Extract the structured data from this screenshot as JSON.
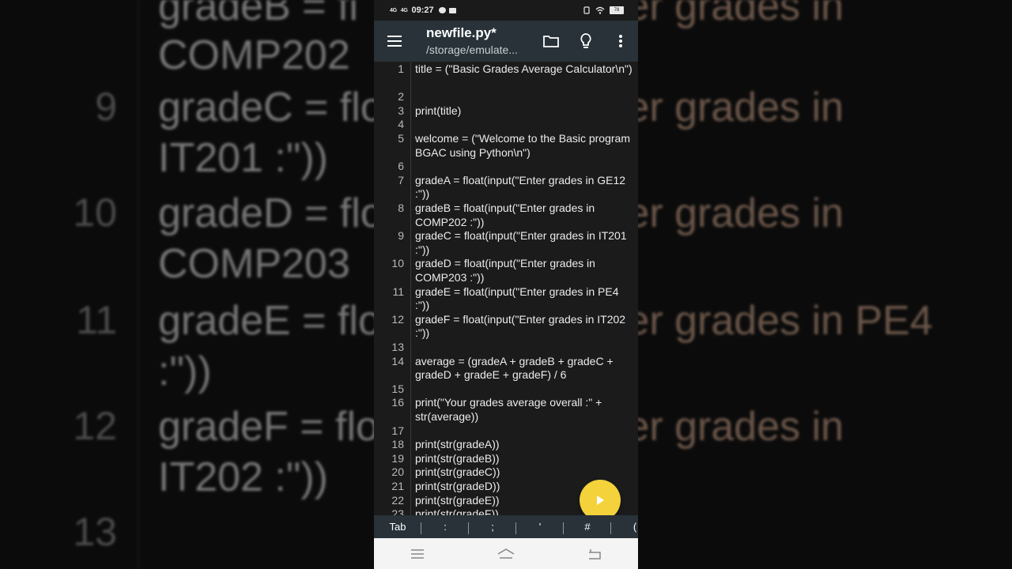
{
  "background": {
    "rows": [
      {
        "num": "",
        "text": "gradeB = fl",
        "right": "ter grades in"
      },
      {
        "num": "",
        "text": "COMP202",
        "right": ""
      },
      {
        "num": "9",
        "text": "gradeC = flo",
        "right": "ter grades in"
      },
      {
        "num": "",
        "text": "IT201 :\"))",
        "right": ""
      },
      {
        "num": "10",
        "text": "gradeD = flo",
        "right": "ter grades in"
      },
      {
        "num": "",
        "text": "COMP203",
        "right": ""
      },
      {
        "num": "11",
        "text": "gradeE = flo",
        "right": "ter grades in PE4"
      },
      {
        "num": "",
        "text": ":\"))",
        "right": ""
      },
      {
        "num": "12",
        "text": "gradeF = flo",
        "right": "ter grades in"
      },
      {
        "num": "",
        "text": "IT202 :\"))",
        "right": ""
      },
      {
        "num": "13",
        "text": "",
        "right": ""
      }
    ]
  },
  "statusbar": {
    "signal_1": "4G",
    "signal_2": "4G",
    "time": "09:27",
    "battery": "78"
  },
  "toolbar": {
    "title": "newfile.py*",
    "path": "/storage/emulate..."
  },
  "editor": {
    "lines": [
      {
        "num": "1",
        "text": "title = (\"Basic Grades Average Calculator\\n\")"
      },
      {
        "num": "2",
        "text": ""
      },
      {
        "num": "3",
        "text": "print(title)"
      },
      {
        "num": "4",
        "text": ""
      },
      {
        "num": "5",
        "text": "welcome = (\"Welcome to the Basic program BGAC using Python\\n\")"
      },
      {
        "num": "6",
        "text": ""
      },
      {
        "num": "7",
        "text": "gradeA = float(input(\"Enter grades in GE12 :\"))"
      },
      {
        "num": "8",
        "text": "gradeB = float(input(\"Enter grades in COMP202 :\"))"
      },
      {
        "num": "9",
        "text": "gradeC = float(input(\"Enter grades in IT201 :\"))"
      },
      {
        "num": "10",
        "text": "gradeD = float(input(\"Enter grades in COMP203 :\"))"
      },
      {
        "num": "11",
        "text": "gradeE = float(input(\"Enter grades in PE4 :\"))"
      },
      {
        "num": "12",
        "text": "gradeF = float(input(\"Enter grades in IT202 :\"))"
      },
      {
        "num": "13",
        "text": ""
      },
      {
        "num": "14",
        "text": "average = (gradeA + gradeB + gradeC + gradeD + gradeE + gradeF) / 6"
      },
      {
        "num": "15",
        "text": ""
      },
      {
        "num": "16",
        "text": "print(\"Your grades average overall :\" + str(average))"
      },
      {
        "num": "17",
        "text": ""
      },
      {
        "num": "18",
        "text": "print(str(gradeA))"
      },
      {
        "num": "19",
        "text": "print(str(gradeB))"
      },
      {
        "num": "20",
        "text": "print(str(gradeC))"
      },
      {
        "num": "21",
        "text": "print(str(gradeD))"
      },
      {
        "num": "22",
        "text": "print(str(gradeE))"
      },
      {
        "num": "23",
        "text": "print(str(gradeF))"
      }
    ]
  },
  "keybar": {
    "keys": [
      "Tab",
      ":",
      ";",
      "'",
      "#",
      "("
    ]
  },
  "colors": {
    "toolbar": "#283238",
    "editor_bg": "#1b1b1b",
    "string": "#c9a38a",
    "paren": "#d8a83c",
    "fab": "#f3d23b"
  }
}
